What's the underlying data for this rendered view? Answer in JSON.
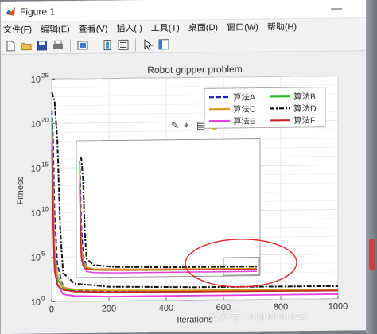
{
  "window": {
    "title": "Figure 1",
    "minimize_glyph": "—"
  },
  "menu": [
    {
      "label": "文件(F)"
    },
    {
      "label": "编辑(E)"
    },
    {
      "label": "查看(V)"
    },
    {
      "label": "插入(I)"
    },
    {
      "label": "工具(T)"
    },
    {
      "label": "桌面(D)"
    },
    {
      "label": "窗口(W)"
    },
    {
      "label": "帮助(H)"
    }
  ],
  "toolbar_icons": [
    "new-figure-icon",
    "open-file-icon",
    "save-icon",
    "print-icon",
    "link-plot-icon",
    "insert-colorbar-icon",
    "insert-legend-icon",
    "edit-plot-arrow-icon",
    "property-inspector-icon"
  ],
  "axes_toolbar_icons": [
    "brush-icon",
    "data-tips-icon",
    "export-icon",
    "pan-icon",
    "zoom-in-icon",
    "zoom-out-icon",
    "home-icon"
  ],
  "colors": {
    "algA": "#1f1fb4",
    "algB": "#22c02a",
    "algC": "#d4a020",
    "algD": "#111111",
    "algE": "#e040e0",
    "algF": "#c8262a",
    "annotation": "#e03030"
  },
  "watermark": {
    "text": "公众号 · algorithmzzy"
  },
  "chart_data": {
    "type": "line",
    "title": "Robot gripper problem",
    "xlabel": "Iterations",
    "ylabel": "Fitness",
    "xlim": [
      0,
      1000
    ],
    "ylim_log10": [
      0,
      25
    ],
    "yscale": "log",
    "xticks": [
      0,
      200,
      400,
      600,
      800,
      1000
    ],
    "yticks_exponent": [
      0,
      5,
      10,
      15,
      20,
      25
    ],
    "grid": true,
    "legend": "top-right",
    "series": [
      {
        "name": "算法A",
        "style": "dashed",
        "x": [
          1,
          5,
          10,
          20,
          40,
          80,
          200,
          500,
          1000
        ],
        "log10y": [
          21.5,
          18,
          10,
          4.2,
          1.6,
          1.2,
          1.1,
          1.05,
          1.0
        ]
      },
      {
        "name": "算法B",
        "style": "solid",
        "x": [
          1,
          5,
          10,
          20,
          40,
          80,
          200,
          500,
          1000
        ],
        "log10y": [
          20.5,
          12,
          5,
          2.5,
          1.5,
          1.1,
          1.0,
          0.95,
          0.9
        ]
      },
      {
        "name": "算法C",
        "style": "solid",
        "x": [
          1,
          5,
          10,
          20,
          40,
          80,
          200,
          500,
          1000
        ],
        "log10y": [
          19,
          13,
          6,
          3,
          1.6,
          1.3,
          1.2,
          1.1,
          1.05
        ]
      },
      {
        "name": "算法D",
        "style": "dashdot",
        "x": [
          1,
          5,
          10,
          20,
          30,
          40,
          80,
          200,
          500,
          1000
        ],
        "log10y": [
          23.5,
          23,
          22.5,
          18,
          8,
          3.2,
          2.0,
          1.6,
          1.45,
          1.4
        ]
      },
      {
        "name": "算法E",
        "style": "solid",
        "x": [
          1,
          5,
          10,
          20,
          40,
          80,
          200,
          500,
          1000
        ],
        "log10y": [
          18,
          10,
          4,
          2.0,
          0.8,
          0.6,
          0.5,
          0.5,
          0.5
        ]
      },
      {
        "name": "算法F",
        "style": "solid",
        "x": [
          1,
          5,
          10,
          20,
          40,
          80,
          200,
          500,
          1000
        ],
        "log10y": [
          17,
          9,
          3.5,
          1.8,
          1.3,
          1.1,
          1.0,
          0.95,
          0.9
        ]
      }
    ]
  }
}
